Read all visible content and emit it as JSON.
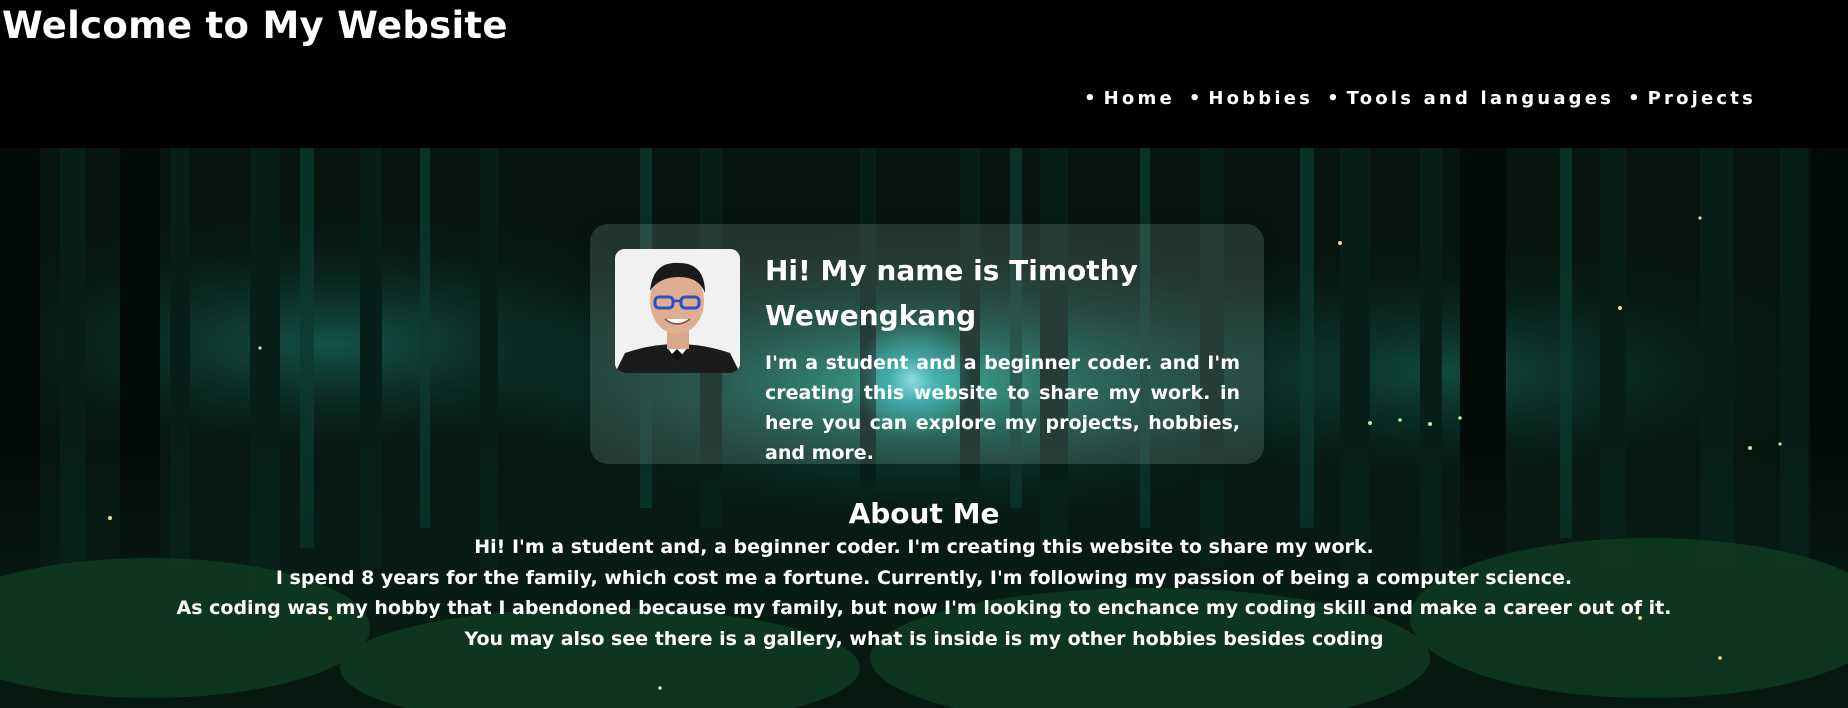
{
  "header": {
    "title": "Welcome to My Website"
  },
  "nav": {
    "items": [
      {
        "label": "Home"
      },
      {
        "label": "Hobbies"
      },
      {
        "label": "Tools and languages"
      },
      {
        "label": "Projects"
      }
    ]
  },
  "profile": {
    "name": "Hi! My name is Timothy Wewengkang",
    "intro": "I'm a student and a beginner coder. and I'm creating this website to share my work. in here you can explore my projects, hobbies, and more."
  },
  "about": {
    "title": "About Me",
    "lines": [
      "Hi! I'm a student and, a beginner coder. I'm creating this website to share my work.",
      "I spend 8 years for the family, which cost me a fortune. Currently, I'm following my passion of being a computer science.",
      "As coding was my hobby that I abendoned because my family, but now I'm looking to enchance my coding skill and make a career out of it.",
      "You may also see there is a gallery, what is inside is my other hobbies besides coding"
    ]
  },
  "colors": {
    "header_background": "#000000",
    "text": "#ffffff",
    "forest_dark": "#04100c",
    "forest_accent": "#1fa890"
  }
}
